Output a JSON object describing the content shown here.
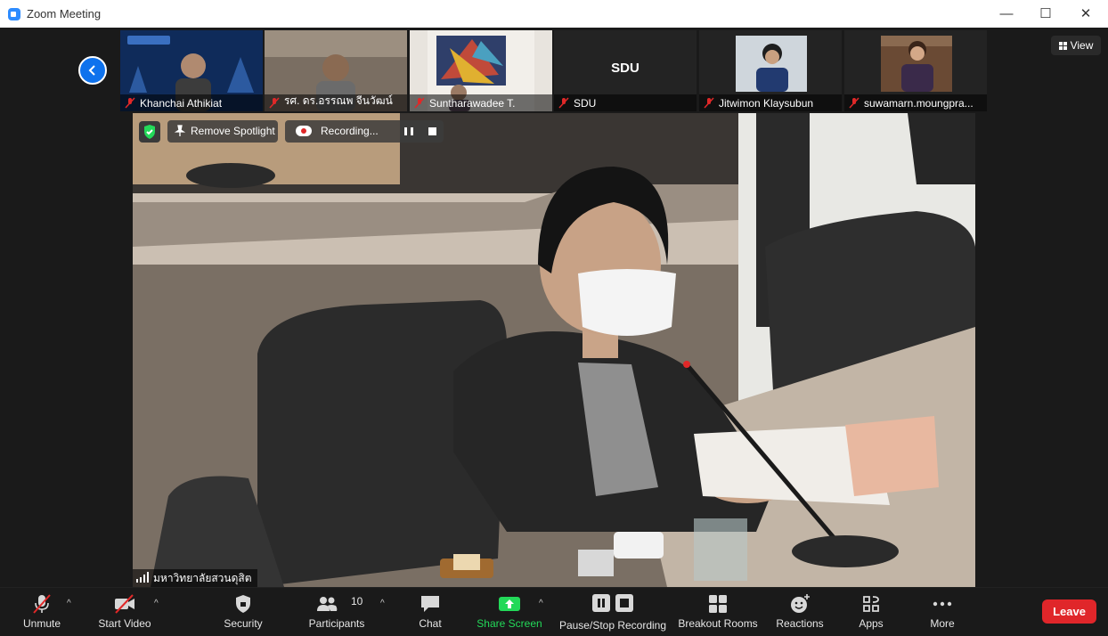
{
  "window": {
    "title": "Zoom Meeting",
    "minimize_glyph": "—",
    "maximize_glyph": "☐",
    "close_glyph": "✕"
  },
  "gallery": {
    "participants": [
      {
        "name": "Khanchai Athikiat",
        "muted": true
      },
      {
        "name": "รศ. ดร.อรรณพ จีนวัฒน์",
        "muted": true
      },
      {
        "name": "Suntharawadee T.",
        "muted": true
      },
      {
        "name": "SDU",
        "muted": true,
        "center_label": "SDU"
      },
      {
        "name": "Jitwimon Klaysubun",
        "muted": true
      },
      {
        "name": "suwamarn.moungpra...",
        "muted": true
      }
    ],
    "view_label": "View"
  },
  "main_video": {
    "spotlight_label": "Remove Spotlight",
    "recording_label": "Recording...",
    "speaker_name": "มหาวิทยาลัยสวนดุสิต"
  },
  "toolbar": {
    "unmute": "Unmute",
    "start_video": "Start Video",
    "security": "Security",
    "participants": "Participants",
    "participants_count": "10",
    "chat": "Chat",
    "share_screen": "Share Screen",
    "pause_stop_recording": "Pause/Stop Recording",
    "breakout_rooms": "Breakout Rooms",
    "reactions": "Reactions",
    "apps": "Apps",
    "more": "More",
    "leave": "Leave"
  },
  "colors": {
    "accent": "#0e72ed",
    "share": "#23d959",
    "leave": "#e0262a",
    "muted": "#e02828"
  }
}
